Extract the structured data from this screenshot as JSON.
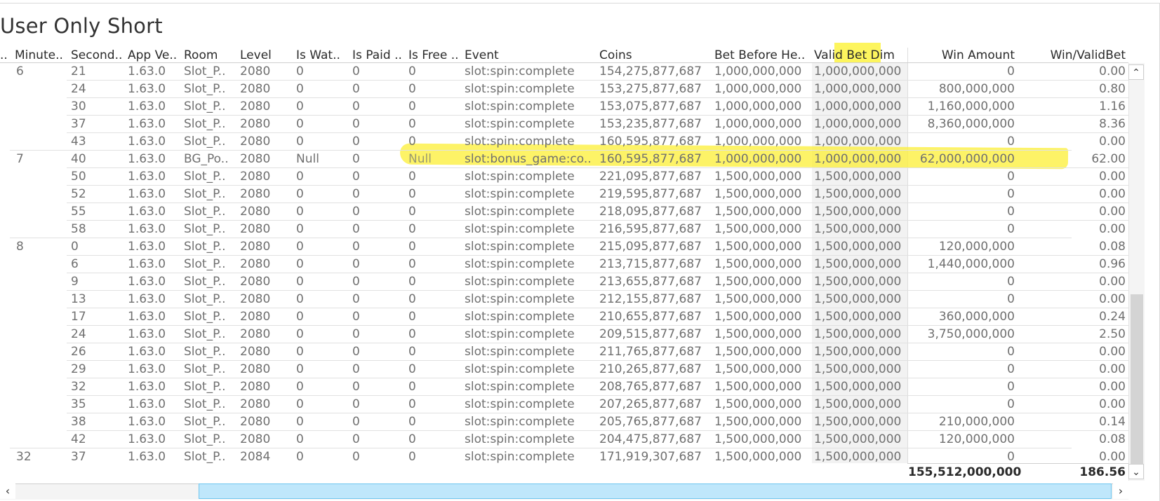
{
  "title": "User Only Short",
  "headers": {
    "c0": "..",
    "minute": "Minute..",
    "second": "Second..",
    "app_ver": "App Ve..",
    "room": "Room",
    "level": "Level",
    "is_wat": "Is Wat..",
    "is_paid": "Is Paid ..",
    "is_free": "Is Free ..",
    "event": "Event",
    "coins": "Coins",
    "bet_before": "Bet Before He..",
    "valid_bet": "Valid Bet Dim",
    "win_amount": "Win Amount",
    "win_valid": "Win/ValidBet"
  },
  "rows": [
    {
      "minute": "6",
      "second": "21",
      "app": "1.63.0",
      "room": "Slot_P..",
      "level": "2080",
      "wat": "0",
      "paid": "0",
      "free": "0",
      "event": "slot:spin:complete",
      "coins": "154,275,877,687",
      "bet": "1,000,000,000",
      "valid": "1,000,000,000",
      "win": "0",
      "ratio": "0.00"
    },
    {
      "minute": "",
      "second": "24",
      "app": "1.63.0",
      "room": "Slot_P..",
      "level": "2080",
      "wat": "0",
      "paid": "0",
      "free": "0",
      "event": "slot:spin:complete",
      "coins": "153,275,877,687",
      "bet": "1,000,000,000",
      "valid": "1,000,000,000",
      "win": "800,000,000",
      "ratio": "0.80"
    },
    {
      "minute": "",
      "second": "30",
      "app": "1.63.0",
      "room": "Slot_P..",
      "level": "2080",
      "wat": "0",
      "paid": "0",
      "free": "0",
      "event": "slot:spin:complete",
      "coins": "153,075,877,687",
      "bet": "1,000,000,000",
      "valid": "1,000,000,000",
      "win": "1,160,000,000",
      "ratio": "1.16"
    },
    {
      "minute": "",
      "second": "37",
      "app": "1.63.0",
      "room": "Slot_P..",
      "level": "2080",
      "wat": "0",
      "paid": "0",
      "free": "0",
      "event": "slot:spin:complete",
      "coins": "153,235,877,687",
      "bet": "1,000,000,000",
      "valid": "1,000,000,000",
      "win": "8,360,000,000",
      "ratio": "8.36"
    },
    {
      "minute": "",
      "second": "43",
      "app": "1.63.0",
      "room": "Slot_P..",
      "level": "2080",
      "wat": "0",
      "paid": "0",
      "free": "0",
      "event": "slot:spin:complete",
      "coins": "160,595,877,687",
      "bet": "1,000,000,000",
      "valid": "1,000,000,000",
      "win": "0",
      "ratio": "0.00"
    },
    {
      "minute": "7",
      "second": "40",
      "app": "1.63.0",
      "room": "BG_Po..",
      "level": "2080",
      "wat": "Null",
      "paid": "0",
      "free": "Null",
      "event": "slot:bonus_game:co..",
      "coins": "160,595,877,687",
      "bet": "1,000,000,000",
      "valid": "1,000,000,000",
      "win": "62,000,000,000",
      "ratio": "62.00"
    },
    {
      "minute": "",
      "second": "50",
      "app": "1.63.0",
      "room": "Slot_P..",
      "level": "2080",
      "wat": "0",
      "paid": "0",
      "free": "0",
      "event": "slot:spin:complete",
      "coins": "221,095,877,687",
      "bet": "1,500,000,000",
      "valid": "1,500,000,000",
      "win": "0",
      "ratio": "0.00"
    },
    {
      "minute": "",
      "second": "52",
      "app": "1.63.0",
      "room": "Slot_P..",
      "level": "2080",
      "wat": "0",
      "paid": "0",
      "free": "0",
      "event": "slot:spin:complete",
      "coins": "219,595,877,687",
      "bet": "1,500,000,000",
      "valid": "1,500,000,000",
      "win": "0",
      "ratio": "0.00"
    },
    {
      "minute": "",
      "second": "55",
      "app": "1.63.0",
      "room": "Slot_P..",
      "level": "2080",
      "wat": "0",
      "paid": "0",
      "free": "0",
      "event": "slot:spin:complete",
      "coins": "218,095,877,687",
      "bet": "1,500,000,000",
      "valid": "1,500,000,000",
      "win": "0",
      "ratio": "0.00"
    },
    {
      "minute": "",
      "second": "58",
      "app": "1.63.0",
      "room": "Slot_P..",
      "level": "2080",
      "wat": "0",
      "paid": "0",
      "free": "0",
      "event": "slot:spin:complete",
      "coins": "216,595,877,687",
      "bet": "1,500,000,000",
      "valid": "1,500,000,000",
      "win": "0",
      "ratio": "0.00"
    },
    {
      "minute": "8",
      "second": "0",
      "app": "1.63.0",
      "room": "Slot_P..",
      "level": "2080",
      "wat": "0",
      "paid": "0",
      "free": "0",
      "event": "slot:spin:complete",
      "coins": "215,095,877,687",
      "bet": "1,500,000,000",
      "valid": "1,500,000,000",
      "win": "120,000,000",
      "ratio": "0.08"
    },
    {
      "minute": "",
      "second": "6",
      "app": "1.63.0",
      "room": "Slot_P..",
      "level": "2080",
      "wat": "0",
      "paid": "0",
      "free": "0",
      "event": "slot:spin:complete",
      "coins": "213,715,877,687",
      "bet": "1,500,000,000",
      "valid": "1,500,000,000",
      "win": "1,440,000,000",
      "ratio": "0.96"
    },
    {
      "minute": "",
      "second": "9",
      "app": "1.63.0",
      "room": "Slot_P..",
      "level": "2080",
      "wat": "0",
      "paid": "0",
      "free": "0",
      "event": "slot:spin:complete",
      "coins": "213,655,877,687",
      "bet": "1,500,000,000",
      "valid": "1,500,000,000",
      "win": "0",
      "ratio": "0.00"
    },
    {
      "minute": "",
      "second": "13",
      "app": "1.63.0",
      "room": "Slot_P..",
      "level": "2080",
      "wat": "0",
      "paid": "0",
      "free": "0",
      "event": "slot:spin:complete",
      "coins": "212,155,877,687",
      "bet": "1,500,000,000",
      "valid": "1,500,000,000",
      "win": "0",
      "ratio": "0.00"
    },
    {
      "minute": "",
      "second": "17",
      "app": "1.63.0",
      "room": "Slot_P..",
      "level": "2080",
      "wat": "0",
      "paid": "0",
      "free": "0",
      "event": "slot:spin:complete",
      "coins": "210,655,877,687",
      "bet": "1,500,000,000",
      "valid": "1,500,000,000",
      "win": "360,000,000",
      "ratio": "0.24"
    },
    {
      "minute": "",
      "second": "24",
      "app": "1.63.0",
      "room": "Slot_P..",
      "level": "2080",
      "wat": "0",
      "paid": "0",
      "free": "0",
      "event": "slot:spin:complete",
      "coins": "209,515,877,687",
      "bet": "1,500,000,000",
      "valid": "1,500,000,000",
      "win": "3,750,000,000",
      "ratio": "2.50"
    },
    {
      "minute": "",
      "second": "26",
      "app": "1.63.0",
      "room": "Slot_P..",
      "level": "2080",
      "wat": "0",
      "paid": "0",
      "free": "0",
      "event": "slot:spin:complete",
      "coins": "211,765,877,687",
      "bet": "1,500,000,000",
      "valid": "1,500,000,000",
      "win": "0",
      "ratio": "0.00"
    },
    {
      "minute": "",
      "second": "29",
      "app": "1.63.0",
      "room": "Slot_P..",
      "level": "2080",
      "wat": "0",
      "paid": "0",
      "free": "0",
      "event": "slot:spin:complete",
      "coins": "210,265,877,687",
      "bet": "1,500,000,000",
      "valid": "1,500,000,000",
      "win": "0",
      "ratio": "0.00"
    },
    {
      "minute": "",
      "second": "32",
      "app": "1.63.0",
      "room": "Slot_P..",
      "level": "2080",
      "wat": "0",
      "paid": "0",
      "free": "0",
      "event": "slot:spin:complete",
      "coins": "208,765,877,687",
      "bet": "1,500,000,000",
      "valid": "1,500,000,000",
      "win": "0",
      "ratio": "0.00"
    },
    {
      "minute": "",
      "second": "35",
      "app": "1.63.0",
      "room": "Slot_P..",
      "level": "2080",
      "wat": "0",
      "paid": "0",
      "free": "0",
      "event": "slot:spin:complete",
      "coins": "207,265,877,687",
      "bet": "1,500,000,000",
      "valid": "1,500,000,000",
      "win": "0",
      "ratio": "0.00"
    },
    {
      "minute": "",
      "second": "38",
      "app": "1.63.0",
      "room": "Slot_P..",
      "level": "2080",
      "wat": "0",
      "paid": "0",
      "free": "0",
      "event": "slot:spin:complete",
      "coins": "205,765,877,687",
      "bet": "1,500,000,000",
      "valid": "1,500,000,000",
      "win": "210,000,000",
      "ratio": "0.14"
    },
    {
      "minute": "",
      "second": "42",
      "app": "1.63.0",
      "room": "Slot_P..",
      "level": "2080",
      "wat": "0",
      "paid": "0",
      "free": "0",
      "event": "slot:spin:complete",
      "coins": "204,475,877,687",
      "bet": "1,500,000,000",
      "valid": "1,500,000,000",
      "win": "120,000,000",
      "ratio": "0.08"
    },
    {
      "minute": "32",
      "second": "37",
      "app": "1.63.0",
      "room": "Slot_P..",
      "level": "2084",
      "wat": "0",
      "paid": "0",
      "free": "0",
      "event": "slot:spin:complete",
      "coins": "171,919,307,687",
      "bet": "1,500,000,000",
      "valid": "1,500,000,000",
      "win": "0",
      "ratio": "0.00"
    }
  ],
  "highlighted_row": 5,
  "totals": {
    "win": "155,512,000,000",
    "ratio": "186.56"
  },
  "scroll": {
    "up_icon": "chevron-up-icon",
    "down_icon": "chevron-down-icon",
    "left_icon": "chevron-left-icon",
    "right_icon": "chevron-right-icon"
  },
  "colors": {
    "highlight": "#fdf55e",
    "hscroll_thumb": "#bfe7fb"
  }
}
